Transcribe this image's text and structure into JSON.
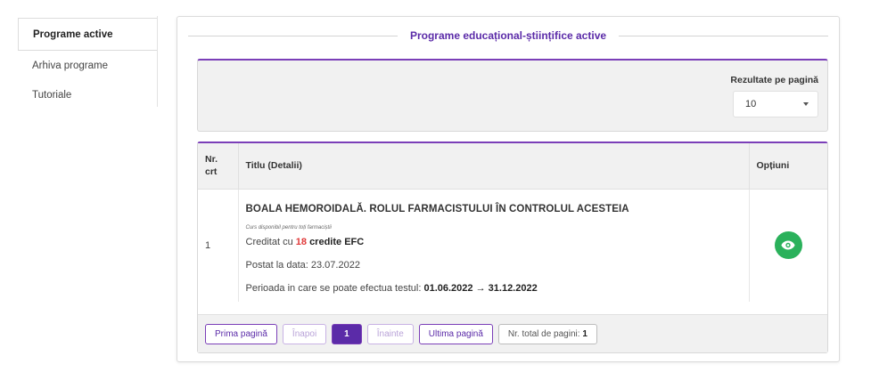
{
  "sidebar": {
    "items": [
      {
        "label": "Programe active",
        "active": true
      },
      {
        "label": "Arhiva programe",
        "active": false
      },
      {
        "label": "Tutoriale",
        "active": false
      }
    ]
  },
  "panel": {
    "title": "Programe educațional-științifice active"
  },
  "filter": {
    "results_label": "Rezultate pe pagină",
    "results_value": "10"
  },
  "table": {
    "headers": {
      "nr": "Nr. crt",
      "title": "Titlu (Detalii)",
      "options": "Opțiuni"
    },
    "rows": [
      {
        "nr": "1",
        "title": "BOALA HEMOROIDALĂ. ROLUL FARMACISTULUI ÎN CONTROLUL ACESTEIA",
        "note": "Curs disponibil pentru toți farmaciștii",
        "credit_prefix": "Creditat cu ",
        "credit_value": "18",
        "credit_suffix": "credite EFC",
        "posted": "Postat la data: 23.07.2022",
        "period_label": "Perioada in care se poate efectua testul: ",
        "period_start": "01.06.2022",
        "period_arrow": "→",
        "period_end": "31.12.2022"
      }
    ]
  },
  "pagination": {
    "first": "Prima pagină",
    "prev": "Înapoi",
    "current": "1",
    "next": "Înainte",
    "last": "Ultima pagină",
    "total_label": "Nr. total de pagini: ",
    "total_value": "1"
  },
  "colors": {
    "accent": "#5b2ba8",
    "view_button": "#2ab15b",
    "credit_red": "#e03a3a"
  },
  "icons": {
    "view": "eye-icon",
    "dropdown": "chevron-down-icon"
  }
}
